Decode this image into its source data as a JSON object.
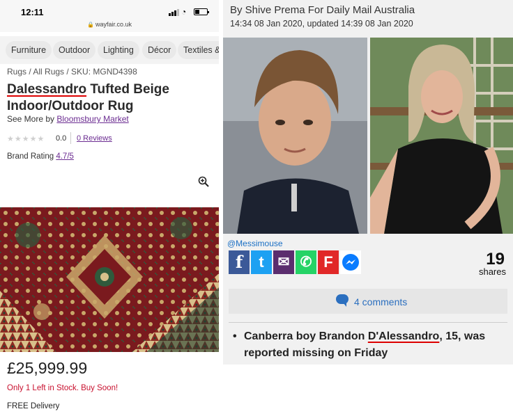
{
  "phone": {
    "time": "12:11",
    "url": "wayfair.co.uk"
  },
  "categories": [
    "Furniture",
    "Outdoor",
    "Lighting",
    "Décor",
    "Textiles &"
  ],
  "product": {
    "breadcrumb": "Rugs / All Rugs / SKU: MGND4398",
    "title_highlight": "Dalessandro",
    "title_rest": " Tufted Beige Indoor/Outdoor Rug",
    "see_more_prefix": "See More by ",
    "see_more_link": "Bloomsbury Market",
    "rating_value": "0.0",
    "reviews_link": "0 Reviews",
    "brand_rating_label": "Brand Rating ",
    "brand_rating_value": "4.7/5",
    "price": "£25,999.99",
    "stock": "Only 1 Left in Stock. Buy Soon!",
    "delivery": "FREE Delivery"
  },
  "article": {
    "byline": "By Shive Prema For Daily Mail Australia",
    "dates": "14:34 08 Jan 2020, updated 14:39 08 Jan 2020",
    "photo_credit": "@Messimouse",
    "share_count": "19",
    "share_label": "shares",
    "comments_label": "4  comments",
    "bullet_pre": "Canberra boy Brandon ",
    "bullet_highlight": "D'Alessandro",
    "bullet_post": ", 15, was reported missing on Friday"
  },
  "share_buttons": [
    {
      "icon": "facebook-icon",
      "glyph": "f",
      "color": "#3b5998"
    },
    {
      "icon": "twitter-icon",
      "glyph": "t",
      "color": "#1da1f2"
    },
    {
      "icon": "email-icon",
      "glyph": "✉",
      "color": "#5b2d6e"
    },
    {
      "icon": "whatsapp-icon",
      "glyph": "✆",
      "color": "#25d366"
    },
    {
      "icon": "flipboard-icon",
      "glyph": "F",
      "color": "#e12828"
    },
    {
      "icon": "messenger-icon",
      "glyph": "⚡",
      "color": "#ffffff"
    }
  ],
  "colors": {
    "link_purple": "#6b2c91",
    "stock_red": "#c8102e",
    "highlight_underline": "#dd0000",
    "comments_blue": "#2b6fbf"
  }
}
